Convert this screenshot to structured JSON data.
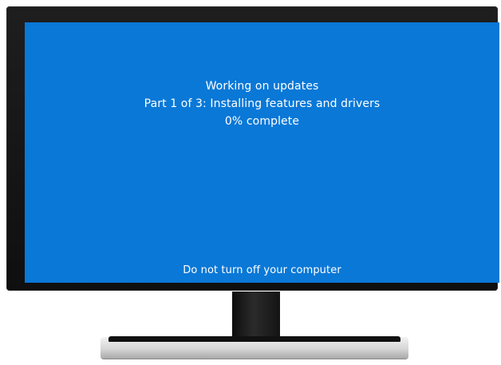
{
  "screen": {
    "title": "Working on updates",
    "subtitle": "Part 1 of 3: Installing features and drivers",
    "progress": "0% complete",
    "progress_fraction": 0,
    "warning": "Do not turn off your computer"
  },
  "colors": {
    "screen_background": "#0a78d7",
    "text": "#ffffff"
  },
  "icons": {
    "power": "power-icon"
  }
}
